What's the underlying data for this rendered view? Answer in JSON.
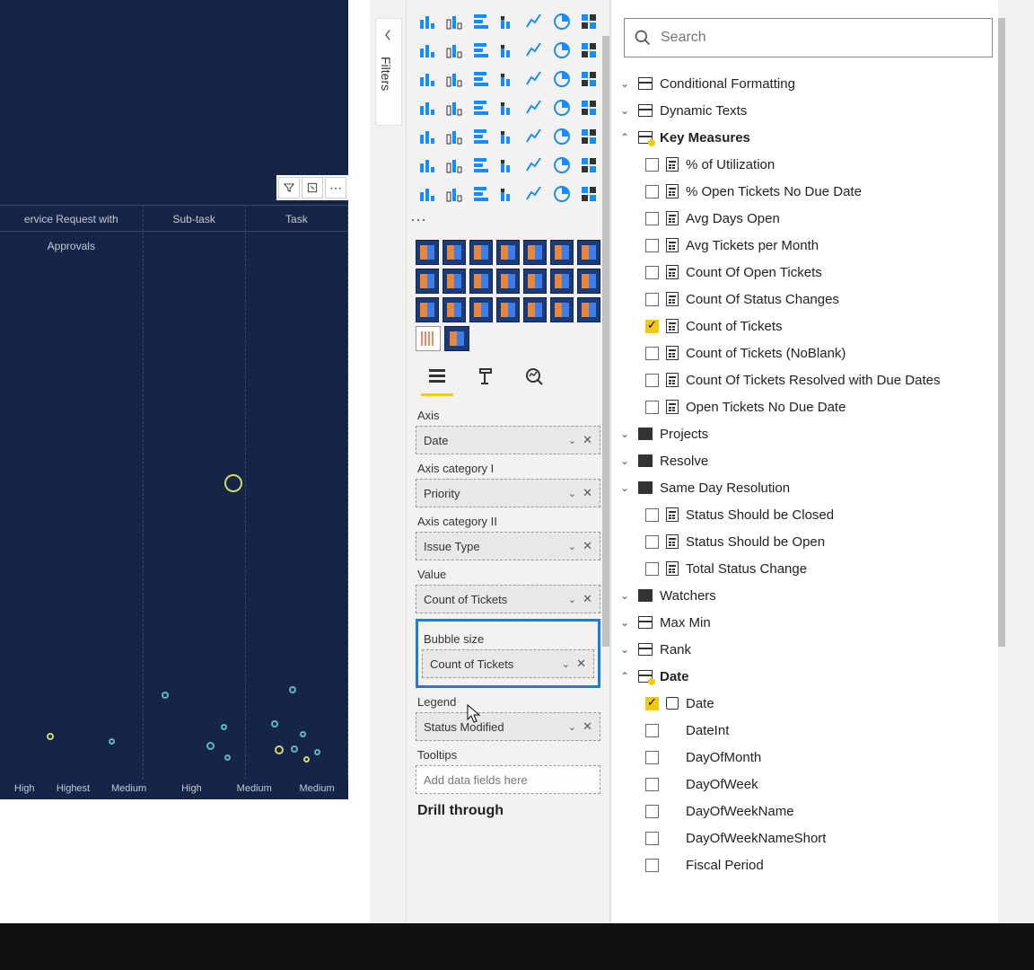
{
  "filters_tab": {
    "label": "Filters"
  },
  "chart": {
    "toolbar_icons": [
      "filter-icon",
      "focus-icon",
      "more-icon"
    ],
    "column_headers": [
      "ervice Request with Approvals",
      "Sub-task",
      "Task"
    ],
    "axis_labels": [
      "High",
      "Highest",
      "Medium",
      "High",
      "Medium",
      "Medium"
    ]
  },
  "viz": {
    "ellipsis": "···"
  },
  "wells": {
    "axis": {
      "label": "Axis",
      "value": "Date"
    },
    "cat1": {
      "label": "Axis category I",
      "value": "Priority"
    },
    "cat2": {
      "label": "Axis category II",
      "value": "Issue Type"
    },
    "value": {
      "label": "Value",
      "value": "Count of Tickets"
    },
    "bubble": {
      "label": "Bubble size",
      "value": "Count of Tickets"
    },
    "legend": {
      "label": "Legend",
      "value": "Status Modified"
    },
    "tooltips": {
      "label": "Tooltips",
      "placeholder": "Add data fields here"
    },
    "drill": "Drill through"
  },
  "search": {
    "placeholder": "Search"
  },
  "tables": {
    "cond": "Conditional Formatting",
    "dyn": "Dynamic Texts",
    "key": "Key Measures",
    "key_measures": [
      "% of Utilization",
      "% Open Tickets No Due Date",
      "Avg Days Open",
      "Avg Tickets per Month",
      "Count Of Open Tickets",
      "Count Of Status Changes",
      "Count of Tickets",
      "Count of Tickets (NoBlank)",
      "Count Of Tickets Resolved with Due Dates",
      "Open Tickets No Due Date"
    ],
    "projects": "Projects",
    "resolve": "Resolve",
    "sameday": "Same Day Resolution",
    "sameday_fields": [
      "Status Should be Closed",
      "Status Should be Open",
      "Total Status Change"
    ],
    "watchers": "Watchers",
    "maxmin": "Max Min",
    "rank": "Rank",
    "date": "Date",
    "date_fields": [
      "Date",
      "DateInt",
      "DayOfMonth",
      "DayOfWeek",
      "DayOfWeekName",
      "DayOfWeekNameShort",
      "Fiscal Period"
    ]
  }
}
